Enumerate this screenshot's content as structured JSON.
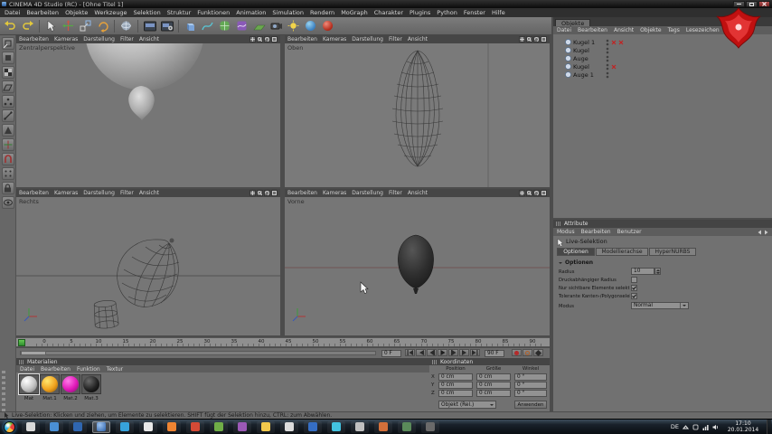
{
  "window": {
    "title": "CINEMA 4D Studio (RC) - [Ohne Titel 1]"
  },
  "menubar": {
    "items": [
      "Datei",
      "Bearbeiten",
      "Objekte",
      "Werkzeuge",
      "Selektion",
      "Struktur",
      "Funktionen",
      "Animation",
      "Simulation",
      "Rendern",
      "MoGraph",
      "Charakter",
      "Plugins",
      "Python",
      "Fenster",
      "Hilfe"
    ]
  },
  "viewport_menu": {
    "items": [
      "Bearbeiten",
      "Kameras",
      "Darstellung",
      "Filter",
      "Ansicht"
    ]
  },
  "viewports": {
    "top_left_label": "Zentralperspektive",
    "top_right_label": "Oben",
    "bottom_left_label": "Rechts",
    "bottom_right_label": "Vorne"
  },
  "object_manager": {
    "tab": "Objekte",
    "menu": [
      "Datei",
      "Bearbeiten",
      "Ansicht",
      "Objekte",
      "Tags",
      "Lesezeichen"
    ],
    "objects": [
      {
        "name": "Kugel 1"
      },
      {
        "name": "Kugel"
      },
      {
        "name": "Auge"
      },
      {
        "name": "Kugel"
      },
      {
        "name": "Auge 1"
      }
    ]
  },
  "attributes": {
    "title": "Attribute",
    "menu": [
      "Modus",
      "Bearbeiten",
      "Benutzer"
    ],
    "tool_name": "Live-Selektion",
    "tabs": [
      "Optionen",
      "Modellierachse",
      "HyperNURBS"
    ],
    "section": "Optionen",
    "radius_label": "Radius",
    "radius_value": "10",
    "pressure_label": "Druckabhängiger Radius",
    "visible_label": "Nur sichtbare Elemente selektieren",
    "tolerant_label": "Tolerante Kanten-/Polygonselektion",
    "mode_label": "Modus",
    "mode_value": "Normal"
  },
  "timeline": {
    "ticks": [
      "0",
      "5",
      "10",
      "15",
      "20",
      "25",
      "30",
      "35",
      "40",
      "45",
      "50",
      "55",
      "60",
      "65",
      "70",
      "75",
      "80",
      "85",
      "90"
    ],
    "start_frame": "0 F",
    "end_frame": "90 F"
  },
  "materials": {
    "title": "Materialien",
    "menu": [
      "Datei",
      "Bearbeiten",
      "Funktion",
      "Textur"
    ],
    "items": [
      {
        "name": "Mat",
        "style": "background:radial-gradient(circle at 35% 30%, #ffffff, #c2c2c2 55%, #6f6f6f)"
      },
      {
        "name": "Mat.1",
        "style": "background:radial-gradient(circle at 35% 30%, #ffe66e, #f0a21e 55%, #8a5200)"
      },
      {
        "name": "Mat.2",
        "style": "background:radial-gradient(circle at 35% 30%, #ff7ae8, #e018b8 55%, #770f62)"
      },
      {
        "name": "Mat.3",
        "style": "background:radial-gradient(circle at 35% 30%, #6a6a6a, #222222 55%, #000000)"
      }
    ]
  },
  "coordinates": {
    "title": "Koordinaten",
    "col_headers": [
      "Position",
      "Größe",
      "Winkel"
    ],
    "row_labels": [
      "X",
      "Y",
      "Z"
    ],
    "position": [
      "0 cm",
      "0 cm",
      "0 cm"
    ],
    "size": [
      "0 cm",
      "0 cm",
      "0 cm"
    ],
    "angle": [
      "0 °",
      "0 °",
      "0 °"
    ],
    "mode": "Objekt (Rel.)",
    "apply_label": "Anwenden"
  },
  "status": {
    "text": "Live-Selektion: Klicken und ziehen, um Elemente zu selektieren. SHIFT fügt der Selektion hinzu, CTRL: zum Abwählen."
  },
  "taskbar": {
    "language": "DE",
    "time": "17:10",
    "date": "20.01.2014"
  }
}
